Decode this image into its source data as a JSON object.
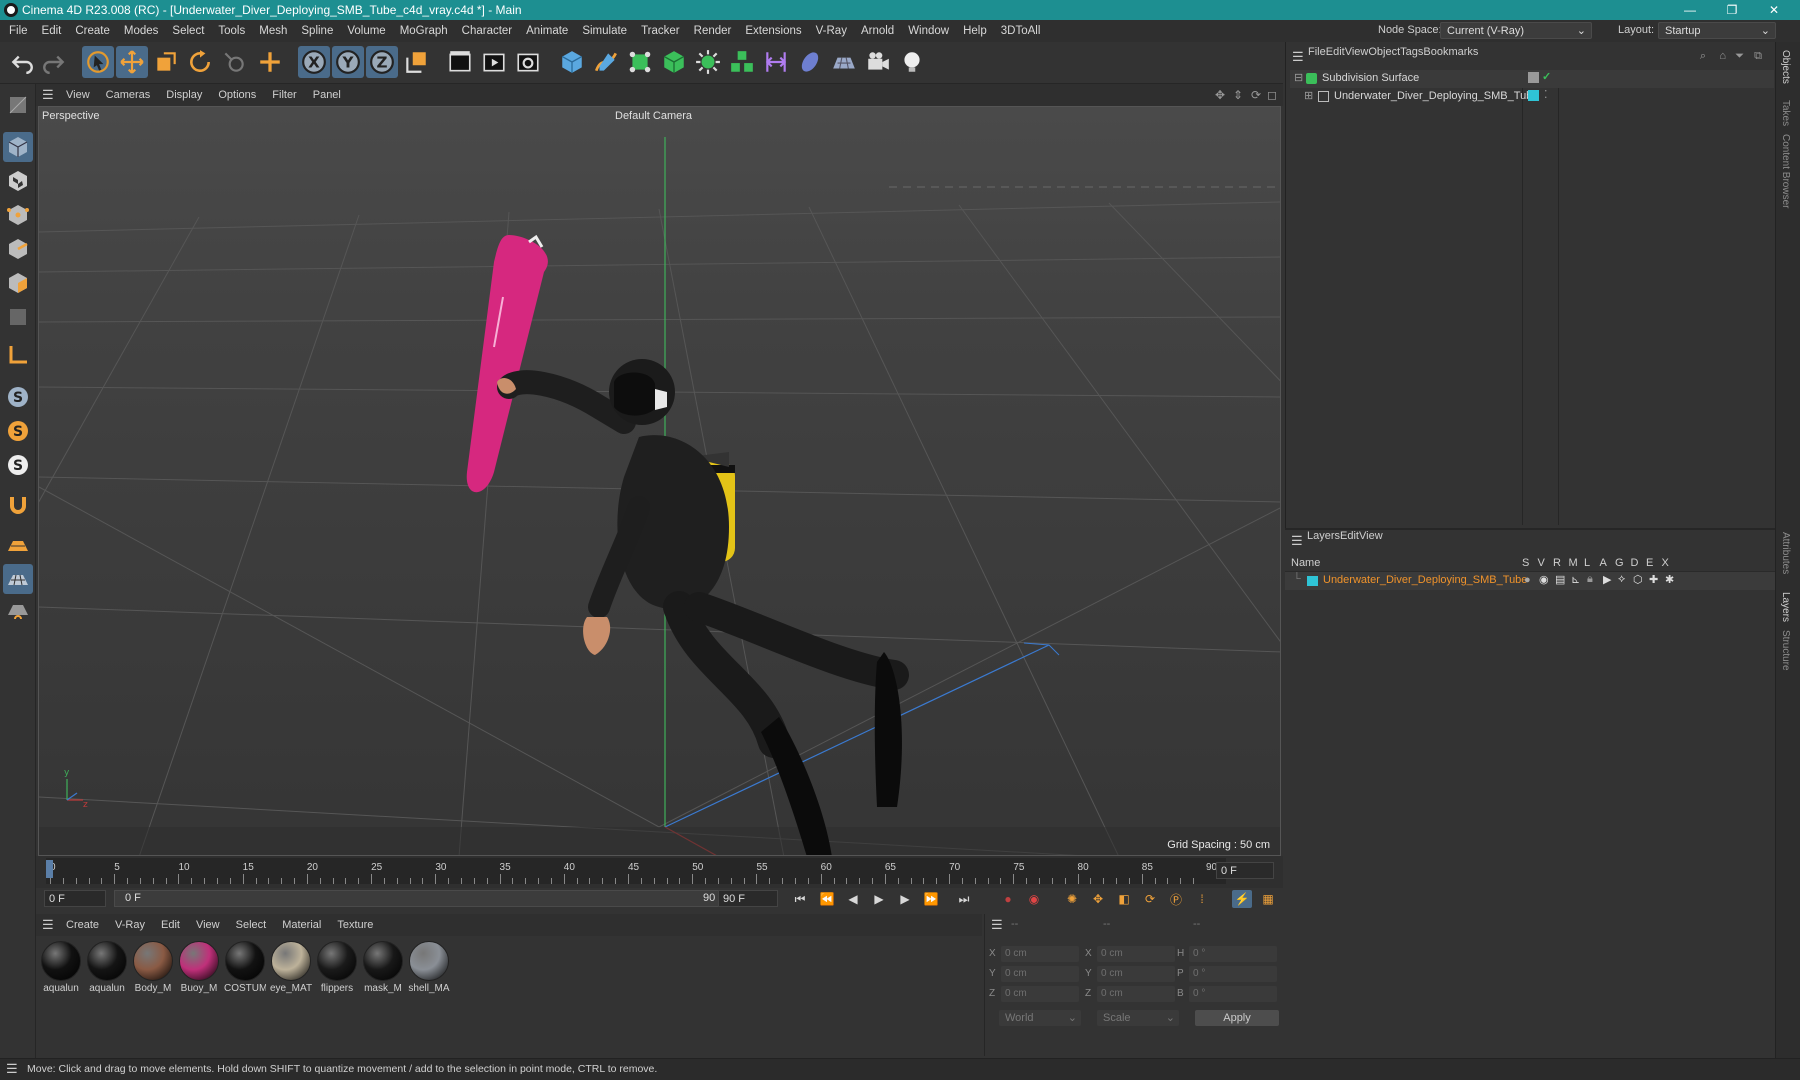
{
  "title_bar": {
    "title": "Cinema 4D R23.008 (RC) - [Underwater_Diver_Deploying_SMB_Tube_c4d_vray.c4d *] - Main",
    "minimize": "—",
    "restore": "❐",
    "close": "✕"
  },
  "menu": [
    "File",
    "Edit",
    "Create",
    "Modes",
    "Select",
    "Tools",
    "Mesh",
    "Spline",
    "Volume",
    "MoGraph",
    "Character",
    "Animate",
    "Simulate",
    "Tracker",
    "Render",
    "Extensions",
    "V-Ray",
    "Arnold",
    "Window",
    "Help",
    "3DToAll"
  ],
  "node_space": {
    "label": "Node Space:",
    "value": "Current (V-Ray)"
  },
  "layout": {
    "label": "Layout:",
    "value": "Startup"
  },
  "viewport_menu": [
    "View",
    "Cameras",
    "Display",
    "Options",
    "Filter",
    "Panel"
  ],
  "viewport": {
    "name": "Perspective",
    "camera": "Default Camera",
    "grid_spacing": "Grid Spacing : 50 cm"
  },
  "timeline": {
    "ticks": [
      "0",
      "5",
      "10",
      "15",
      "20",
      "25",
      "30",
      "35",
      "40",
      "45",
      "50",
      "55",
      "60",
      "65",
      "70",
      "75",
      "80",
      "85",
      "90"
    ],
    "current_frame": "0 F"
  },
  "transport": {
    "start": "0 F",
    "range_start": "0 F",
    "range_end": "90 F",
    "end": "90 F"
  },
  "material_menu": [
    "Create",
    "V-Ray",
    "Edit",
    "View",
    "Select",
    "Material",
    "Texture"
  ],
  "materials": [
    {
      "name": "aqualun",
      "color": "#111111"
    },
    {
      "name": "aqualun",
      "color": "#141414"
    },
    {
      "name": "Body_M",
      "color": "#8a5a44"
    },
    {
      "name": "Buoy_M",
      "color": "#c0307a"
    },
    {
      "name": "COSTUM",
      "color": "#121212"
    },
    {
      "name": "eye_MAT",
      "color": "#bdb29a"
    },
    {
      "name": "flippers",
      "color": "#1a1a1a"
    },
    {
      "name": "mask_M",
      "color": "#181818"
    },
    {
      "name": "shell_MA",
      "color": "#8a8f96"
    }
  ],
  "coords": {
    "header": [
      "--",
      "--",
      "--"
    ],
    "rows": [
      {
        "a": "X",
        "av": "0 cm",
        "b": "X",
        "bv": "0 cm",
        "c": "H",
        "cv": "0 °"
      },
      {
        "a": "Y",
        "av": "0 cm",
        "b": "Y",
        "bv": "0 cm",
        "c": "P",
        "cv": "0 °"
      },
      {
        "a": "Z",
        "av": "0 cm",
        "b": "Z",
        "bv": "0 cm",
        "c": "B",
        "cv": "0 °"
      }
    ],
    "mode": "World",
    "scale": "Scale",
    "apply": "Apply"
  },
  "objects_menu": [
    "File",
    "Edit",
    "View",
    "Object",
    "Tags",
    "Bookmarks"
  ],
  "objects": [
    {
      "name": "Subdivision Surface"
    },
    {
      "name": "Underwater_Diver_Deploying_SMB_Tube"
    }
  ],
  "layers_menu": [
    "Layers",
    "Edit",
    "View"
  ],
  "layers": {
    "name_header": "Name",
    "flags": [
      "S",
      "V",
      "R",
      "M",
      "L",
      "A",
      "G",
      "D",
      "E",
      "X"
    ],
    "rows": [
      {
        "name": "Underwater_Diver_Deploying_SMB_Tube"
      }
    ]
  },
  "right_tabs": [
    "Objects",
    "Takes",
    "Content Browser",
    "Attributes",
    "Layers",
    "Structure"
  ],
  "status": "Move: Click and drag to move elements. Hold down SHIFT to quantize movement / add to the selection in point mode, CTRL to remove.",
  "colors": {
    "accent": "#1d8f91",
    "layer_name": "#f0932b",
    "layer_swatch": "#2fc4d6",
    "buoy": "#d6287f",
    "tank": "#e3c317"
  }
}
